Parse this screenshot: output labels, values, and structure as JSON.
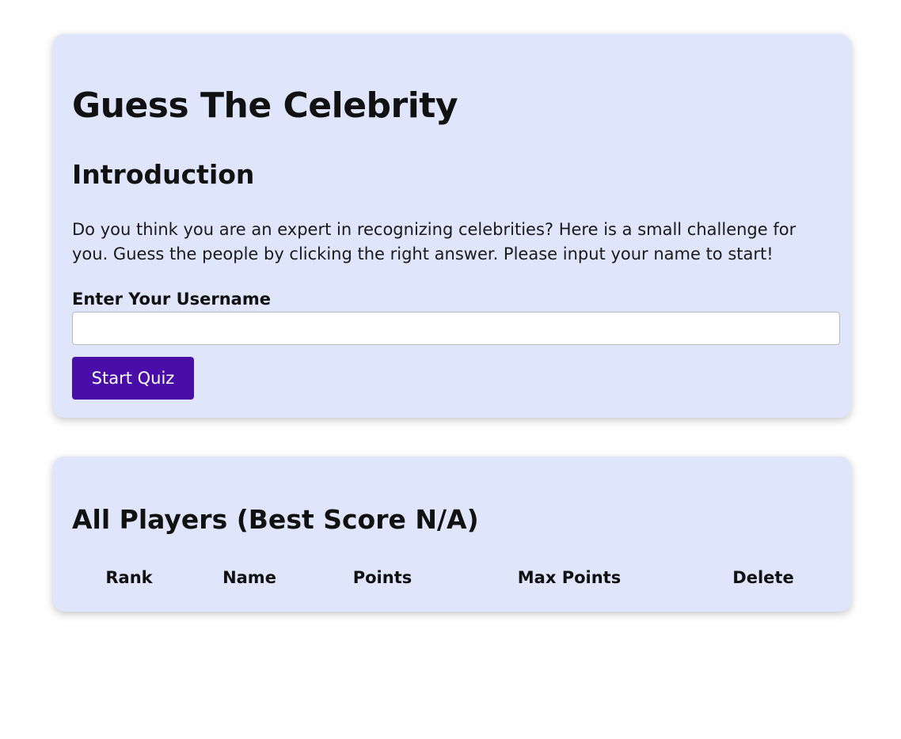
{
  "intro": {
    "title": "Guess The Celebrity",
    "subtitle": "Introduction",
    "description": "Do you think you are an expert in recognizing celebrities? Here is a small challenge for you. Guess the people by clicking the right answer. Please input your name to start!",
    "username_label": "Enter Your Username",
    "username_value": "",
    "username_placeholder": "",
    "start_button_label": "Start Quiz",
    "accent_color": "#4a0ea8",
    "card_color": "#dfe6fb"
  },
  "players": {
    "title": "All Players (Best Score N/A)",
    "columns": [
      "Rank",
      "Name",
      "Points",
      "Max Points",
      "Delete"
    ],
    "rows": []
  }
}
